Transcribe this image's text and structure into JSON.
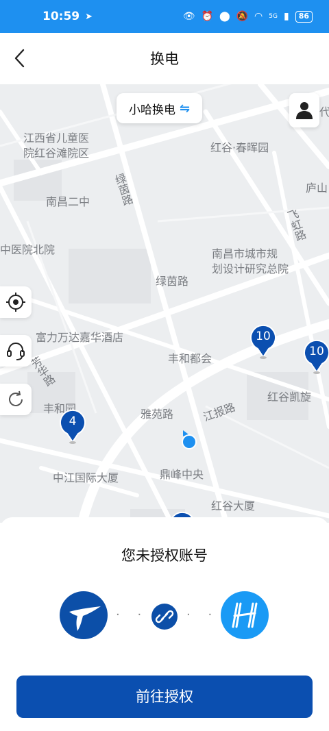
{
  "status_bar": {
    "time": "10:59",
    "network": "5G",
    "battery": "86"
  },
  "nav": {
    "title": "换电"
  },
  "map": {
    "brand_chip": {
      "label": "小哈换电"
    },
    "labels": {
      "hospital": "江西省儿童医\n院红谷滩院区",
      "chunhui": "红谷·春晖园",
      "lu_yin_lu_v": "绿茵路",
      "nanchang_2": "南昌二中",
      "lushan": "庐山",
      "feihong_lu": "飞虹路",
      "zhongyi": "中医院北院",
      "planning": "南昌市城市规\n划设计研究总院",
      "lu_yin_lu": "绿茵路",
      "wanda": "富力万达嘉华酒店",
      "fenghe": "丰和都会",
      "fanghua_lu": "芳华路",
      "feng_yuan": "丰和园",
      "hongshu": "红谷凯旋",
      "yayuan_lu": "雅苑路",
      "jiangbao_lu": "江报路",
      "dingfeng": "鼎峰中央",
      "zhongjiang": "中江国际大厦",
      "hongu_dasha": "红谷大厦",
      "dai": "代"
    },
    "pins": [
      {
        "count": "10"
      },
      {
        "count": "10"
      },
      {
        "count": "4"
      }
    ]
  },
  "sheet": {
    "title": "您未授权账号",
    "dots": "· · ·",
    "button_label": "前往授权"
  },
  "colors": {
    "primary": "#0b4fb0",
    "accent": "#1e90f0"
  }
}
